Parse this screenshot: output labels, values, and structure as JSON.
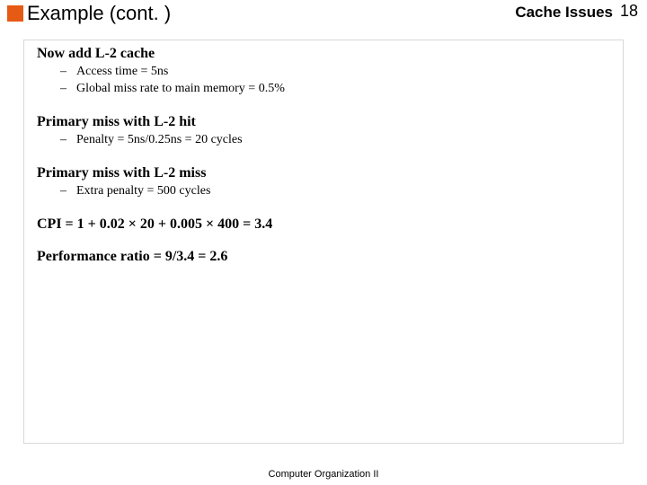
{
  "header": {
    "title": "Example (cont. )",
    "topic": "Cache Issues",
    "page": "18"
  },
  "sections": {
    "s1": {
      "heading": "Now add L-2 cache",
      "b1": "Access time = 5ns",
      "b2": "Global miss rate to main memory = 0.5%"
    },
    "s2": {
      "heading": "Primary miss with L-2 hit",
      "b1": "Penalty = 5ns/0.25ns = 20 cycles"
    },
    "s3": {
      "heading": "Primary miss with L-2 miss",
      "b1": "Extra penalty = 500 cycles"
    },
    "s4": {
      "heading": "CPI = 1 + 0.02 × 20 + 0.005 × 400 = 3.4"
    },
    "s5": {
      "heading": "Performance ratio = 9/3.4 = 2.6"
    }
  },
  "footer": "Computer Organization II"
}
